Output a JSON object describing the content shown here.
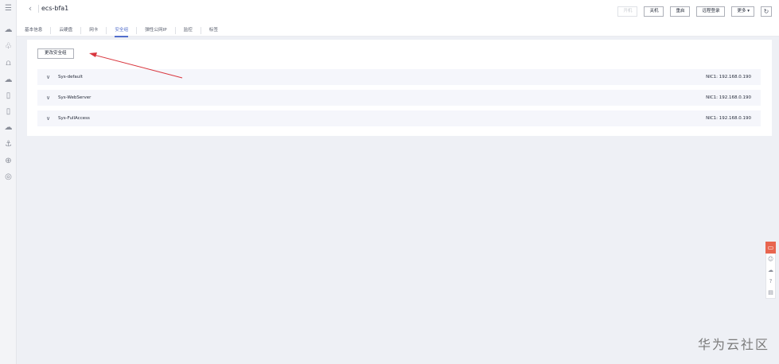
{
  "rail": {
    "icons": [
      "menu-icon",
      "cloud-icon",
      "nodes-icon",
      "mountains-icon",
      "cloud-download-icon",
      "document-icon",
      "clipboard-icon",
      "cloud-upload-icon",
      "anchor-icon",
      "globe-icon",
      "compass-icon"
    ],
    "glyphs": [
      "☰",
      "☁",
      "♧",
      "⩍",
      "☁",
      "▯",
      "▯",
      "☁",
      "⚓",
      "⊕",
      "◎"
    ]
  },
  "header": {
    "back_glyph": "‹",
    "title": "ecs-bfa1",
    "tabs": [
      {
        "label": "基本信息",
        "active": false
      },
      {
        "label": "云硬盘",
        "active": false
      },
      {
        "label": "网卡",
        "active": false
      },
      {
        "label": "安全组",
        "active": true
      },
      {
        "label": "弹性公网IP",
        "active": false
      },
      {
        "label": "监控",
        "active": false
      },
      {
        "label": "标签",
        "active": false
      }
    ],
    "actions": {
      "start": "开机",
      "stop": "关机",
      "restart": "重启",
      "remote_login": "远程登录",
      "more": "更多 ▾",
      "refresh_glyph": "↻"
    }
  },
  "panel": {
    "change_button": "更改安全组",
    "security_groups": [
      {
        "name": "Sys-default",
        "nic": "NIC1: 192.168.0.190"
      },
      {
        "name": "Sys-WebServer",
        "nic": "NIC1: 192.168.0.190"
      },
      {
        "name": "Sys-FullAccess",
        "nic": "NIC1: 192.168.0.190"
      }
    ],
    "chevron_glyph": "∨"
  },
  "float_bar": {
    "top_glyph": "▭",
    "items": [
      "☺",
      "☁",
      "?",
      "▤"
    ],
    "icons": [
      "feedback-icon",
      "smile-icon",
      "cloud-icon",
      "help-icon",
      "document-icon"
    ]
  },
  "annotation": {
    "color": "#d9363e"
  },
  "watermark": "华为云社区"
}
